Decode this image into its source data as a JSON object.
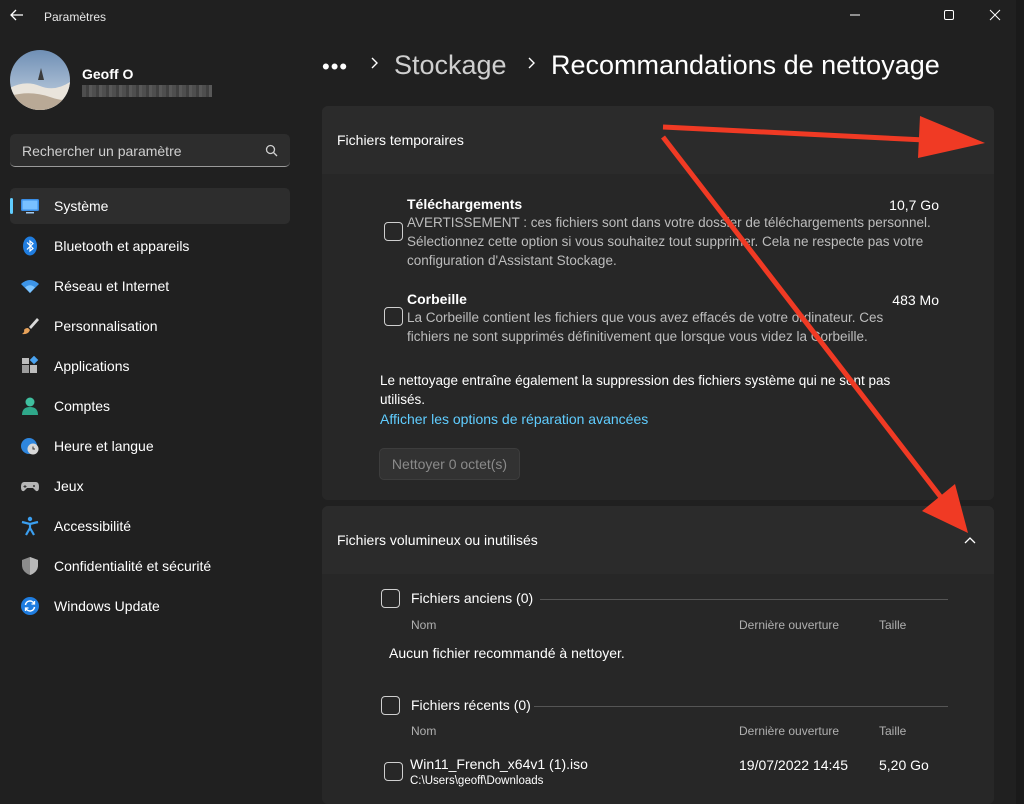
{
  "window": {
    "title": "Paramètres",
    "back_icon": "back-arrow-icon",
    "controls": [
      "minimize-icon",
      "maximize-icon",
      "close-icon"
    ]
  },
  "user": {
    "name": "Geoff O"
  },
  "search": {
    "placeholder": "Rechercher un paramètre",
    "icon": "search-icon"
  },
  "sidebar": {
    "items": [
      {
        "label": "Système",
        "icon": "system-icon",
        "active": true
      },
      {
        "label": "Bluetooth et appareils",
        "icon": "bluetooth-icon"
      },
      {
        "label": "Réseau et Internet",
        "icon": "wifi-icon"
      },
      {
        "label": "Personnalisation",
        "icon": "brush-icon"
      },
      {
        "label": "Applications",
        "icon": "apps-icon"
      },
      {
        "label": "Comptes",
        "icon": "account-icon"
      },
      {
        "label": "Heure et langue",
        "icon": "clock-globe-icon"
      },
      {
        "label": "Jeux",
        "icon": "gamepad-icon"
      },
      {
        "label": "Accessibilité",
        "icon": "accessibility-icon"
      },
      {
        "label": "Confidentialité et sécurité",
        "icon": "shield-icon"
      },
      {
        "label": "Windows Update",
        "icon": "update-icon"
      }
    ]
  },
  "breadcrumb": {
    "dots": "•••",
    "parent": "Stockage",
    "current": "Recommandations de nettoyage"
  },
  "temp_files": {
    "title": "Fichiers temporaires",
    "items": [
      {
        "title": "Téléchargements",
        "size": "10,7 Go",
        "desc": "AVERTISSEMENT : ces fichiers sont dans votre dossier de téléchargements personnel. Sélectionnez cette option si vous souhaitez tout supprimer. Cela ne respecte pas votre configuration d'Assistant Stockage."
      },
      {
        "title": "Corbeille",
        "size": "483 Mo",
        "desc": "La Corbeille contient les fichiers que vous avez effacés de votre ordinateur. Ces fichiers ne sont supprimés définitivement que lorsque vous videz la Corbeille."
      }
    ],
    "note": "Le nettoyage entraîne également la suppression des fichiers système qui ne sont pas utilisés.",
    "link": "Afficher les options de réparation avancées",
    "button": "Nettoyer 0 octet(s)"
  },
  "large_files": {
    "title": "Fichiers volumineux ou inutilisés",
    "columns": {
      "name": "Nom",
      "opened": "Dernière ouverture",
      "size": "Taille"
    },
    "old_group": {
      "title": "Fichiers anciens (0)",
      "empty": "Aucun fichier recommandé à nettoyer."
    },
    "recent_group": {
      "title": "Fichiers récents (0)",
      "files": [
        {
          "name": "Win11_French_x64v1 (1).iso",
          "path": "C:\\Users\\geoff\\Downloads",
          "opened": "19/07/2022 14:45",
          "size": "5,20 Go"
        }
      ]
    }
  },
  "colors": {
    "background": "#202020",
    "card": "#2b2b2b",
    "accent": "#60cdff",
    "annotation_arrow": "#f03a24"
  }
}
